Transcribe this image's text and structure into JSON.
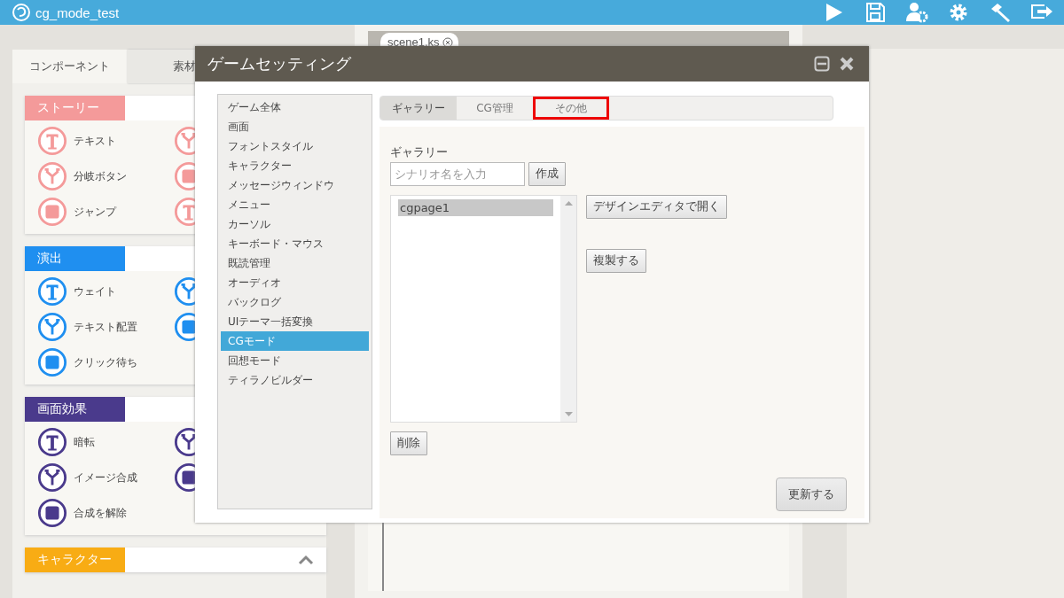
{
  "app_bar": {
    "title": "cg_mode_test"
  },
  "left_panel": {
    "tabs": [
      {
        "label": "コンポーネント",
        "selected": true
      },
      {
        "label": "素材",
        "selected": false
      }
    ],
    "sections": [
      {
        "title": "ストーリー",
        "color": "#f49a9a",
        "collapse_button": false,
        "items": [
          {
            "kind": "labeled",
            "label": "テキスト"
          },
          {
            "kind": "icon-only"
          },
          {
            "kind": "labeled",
            "label": "分岐ボタン"
          },
          {
            "kind": "icon-only"
          },
          {
            "kind": "labeled",
            "label": "ジャンプ"
          },
          {
            "kind": "icon-only"
          }
        ]
      },
      {
        "title": "演出",
        "color": "#1f8ff0",
        "collapse_button": false,
        "items": [
          {
            "kind": "labeled",
            "label": "ウェイト"
          },
          {
            "kind": "icon-only"
          },
          {
            "kind": "labeled",
            "label": "テキスト配置"
          },
          {
            "kind": "icon-only"
          },
          {
            "kind": "labeled",
            "label": "クリック待ち"
          }
        ]
      },
      {
        "title": "画面効果",
        "color": "#4a3a8c",
        "collapse_button": false,
        "items": [
          {
            "kind": "labeled",
            "label": "暗転"
          },
          {
            "kind": "icon-only"
          },
          {
            "kind": "labeled",
            "label": "イメージ合成"
          },
          {
            "kind": "icon-only"
          },
          {
            "kind": "labeled",
            "label": "合成を解除"
          }
        ]
      },
      {
        "title": "キャラクター",
        "color": "#f8ac14",
        "collapse_button": true
      }
    ]
  },
  "editor": {
    "tabs": [
      {
        "label": "scene1.ks"
      }
    ]
  },
  "dialog": {
    "title": "ゲームセッティング",
    "menu": [
      {
        "label": "ゲーム全体",
        "selected": false
      },
      {
        "label": "画面",
        "selected": false
      },
      {
        "label": "フォントスタイル",
        "selected": false
      },
      {
        "label": "キャラクター",
        "selected": false
      },
      {
        "label": "メッセージウィンドウ",
        "selected": false
      },
      {
        "label": "メニュー",
        "selected": false
      },
      {
        "label": "カーソル",
        "selected": false
      },
      {
        "label": "キーボード・マウス",
        "selected": false
      },
      {
        "label": "既読管理",
        "selected": false
      },
      {
        "label": "オーディオ",
        "selected": false
      },
      {
        "label": "バックログ",
        "selected": false
      },
      {
        "label": "UIテーマ一括変換",
        "selected": false
      },
      {
        "label": "CGモード",
        "selected": true
      },
      {
        "label": "回想モード",
        "selected": false
      },
      {
        "label": "ティラノビルダー",
        "selected": false
      }
    ],
    "tabs": [
      {
        "label": "ギャラリー",
        "selected": true,
        "highlighted": false
      },
      {
        "label": "CG管理",
        "selected": false,
        "highlighted": false
      },
      {
        "label": "その他",
        "selected": false,
        "highlighted": true
      }
    ],
    "gallery": {
      "heading": "ギャラリー",
      "name_field": {
        "placeholder": "シナリオ名を入力"
      },
      "create_button": "作成",
      "pages": [
        {
          "label": "cgpage1",
          "selected": true
        }
      ],
      "open_button": "デザインエディタで開く",
      "duplicate_button": "複製する",
      "delete_button": "削除"
    },
    "update_button": "更新する"
  }
}
